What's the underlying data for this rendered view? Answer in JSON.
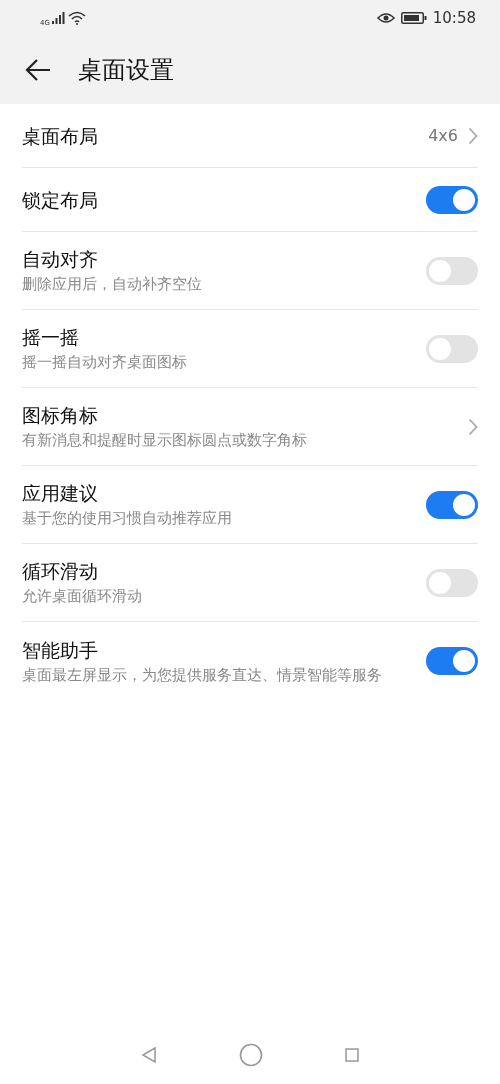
{
  "status_bar": {
    "network": "4G",
    "time": "10:58"
  },
  "header": {
    "title": "桌面设置"
  },
  "settings": [
    {
      "kind": "value",
      "title": "桌面布局",
      "value": "4x6"
    },
    {
      "kind": "toggle",
      "title": "锁定布局",
      "on": true
    },
    {
      "kind": "toggle",
      "title": "自动对齐",
      "subtitle": "删除应用后，自动补齐空位",
      "on": false
    },
    {
      "kind": "toggle",
      "title": "摇一摇",
      "subtitle": "摇一摇自动对齐桌面图标",
      "on": false
    },
    {
      "kind": "link",
      "title": "图标角标",
      "subtitle": "有新消息和提醒时显示图标圆点或数字角标"
    },
    {
      "kind": "toggle",
      "title": "应用建议",
      "subtitle": "基于您的使用习惯自动推荐应用",
      "on": true
    },
    {
      "kind": "toggle",
      "title": "循环滑动",
      "subtitle": "允许桌面循环滑动",
      "on": false
    },
    {
      "kind": "toggle",
      "title": "智能助手",
      "subtitle": "桌面最左屏显示，为您提供服务直达、情景智能等服务",
      "on": true
    }
  ]
}
